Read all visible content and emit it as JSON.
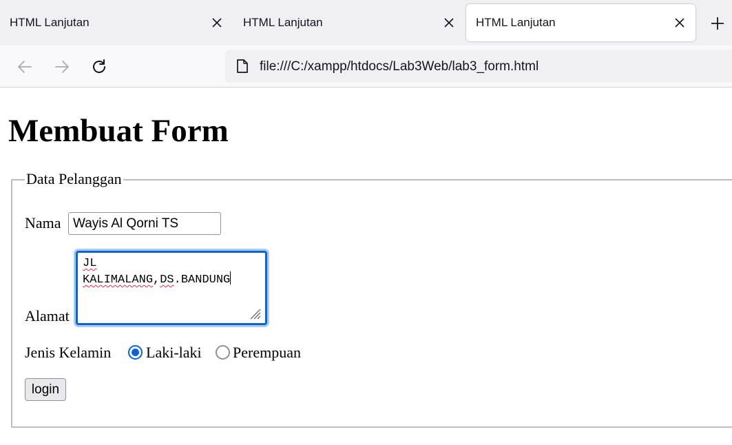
{
  "browser": {
    "tabs": [
      {
        "title": "HTML Lanjutan",
        "active": false
      },
      {
        "title": "HTML Lanjutan",
        "active": false
      },
      {
        "title": "HTML Lanjutan",
        "active": true
      }
    ],
    "url": "file:///C:/xampp/htdocs/Lab3Web/lab3_form.html",
    "icons": {
      "tab_close": "close-icon",
      "new_tab": "plus-icon",
      "back": "back-arrow-icon",
      "forward": "forward-arrow-icon",
      "reload": "reload-icon",
      "page": "page-icon"
    }
  },
  "page": {
    "title": "Membuat Form",
    "fieldset_legend": "Data Pelanggan",
    "nama": {
      "label": "Nama",
      "value": "Wayis Al Qorni TS"
    },
    "alamat": {
      "label": "Alamat",
      "line1": "JL",
      "line2_a": "KALIMALANG",
      "line2_b": ",",
      "line2_c": "DS",
      "line2_d": ".BANDUNG"
    },
    "jenis_kelamin": {
      "label": "Jenis Kelamin",
      "options": [
        {
          "label": "Laki-laki",
          "checked": true
        },
        {
          "label": "Perempuan",
          "checked": false
        }
      ]
    },
    "submit_label": "login"
  },
  "colors": {
    "accent": "#0b63d6",
    "focus_ring": "#a6cdf3",
    "spellcheck": "#e22850",
    "tabstrip_bg": "#f0f0f4",
    "navbar_bg": "#f9f9fb"
  }
}
